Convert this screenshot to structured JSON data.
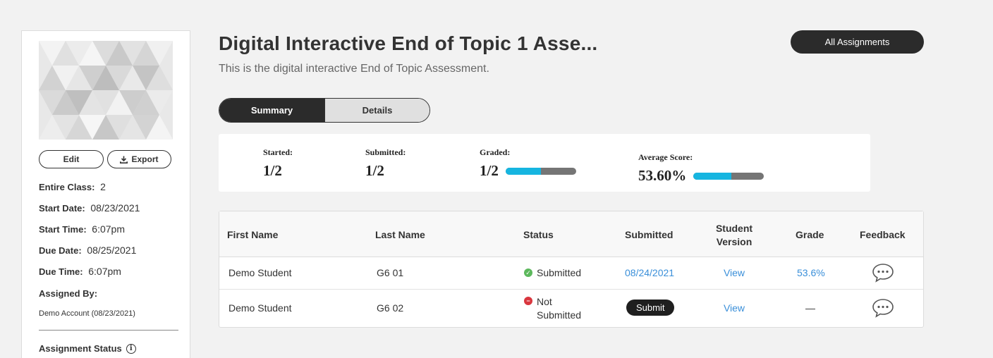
{
  "header": {
    "title": "Digital Interactive End of Topic 1 Asse...",
    "subtitle": "This is the digital interactive End of Topic Assessment.",
    "all_assignments_label": "All Assignments"
  },
  "sidebar": {
    "edit_label": "Edit",
    "export_label": "Export",
    "entire_class_label": "Entire Class:",
    "entire_class_value": "2",
    "start_date_label": "Start Date:",
    "start_date_value": "08/23/2021",
    "start_time_label": "Start Time:",
    "start_time_value": "6:07pm",
    "due_date_label": "Due Date:",
    "due_date_value": "08/25/2021",
    "due_time_label": "Due Time:",
    "due_time_value": "6:07pm",
    "assigned_by_label": "Assigned By:",
    "assigned_by_value": "Demo Account (08/23/2021)",
    "assignment_status_label": "Assignment Status"
  },
  "tabs": {
    "summary": "Summary",
    "details": "Details",
    "active": "summary"
  },
  "stats": {
    "started_label": "Started:",
    "started_value": "1/2",
    "submitted_label": "Submitted:",
    "submitted_value": "1/2",
    "graded_label": "Graded:",
    "graded_value": "1/2",
    "graded_fraction": 0.5,
    "average_label": "Average Score:",
    "average_value": "53.60%",
    "average_fraction": 0.536
  },
  "table": {
    "headers": {
      "first_name": "First Name",
      "last_name": "Last Name",
      "status": "Status",
      "submitted": "Submitted",
      "student_version_line1": "Student",
      "student_version_line2": "Version",
      "grade": "Grade",
      "feedback": "Feedback"
    },
    "rows": [
      {
        "first_name": "Demo Student",
        "last_name": "G6 01",
        "status_line1": "Submitted",
        "status_line2": "",
        "submitted": "08/24/2021",
        "student_version": "View",
        "grade": "53.6%"
      },
      {
        "first_name": "Demo Student",
        "last_name": "G6 02",
        "status_line1": "Not",
        "status_line2": "Submitted",
        "submit_label": "Submit",
        "student_version": "View",
        "grade": "—"
      }
    ]
  },
  "colors": {
    "accent_bar": "#16b5e0",
    "bar_track": "#757575",
    "link": "#3a8fd9",
    "dark_button": "#2b2b2b",
    "status_ok": "#5cb85c",
    "status_error": "#d9363e"
  }
}
